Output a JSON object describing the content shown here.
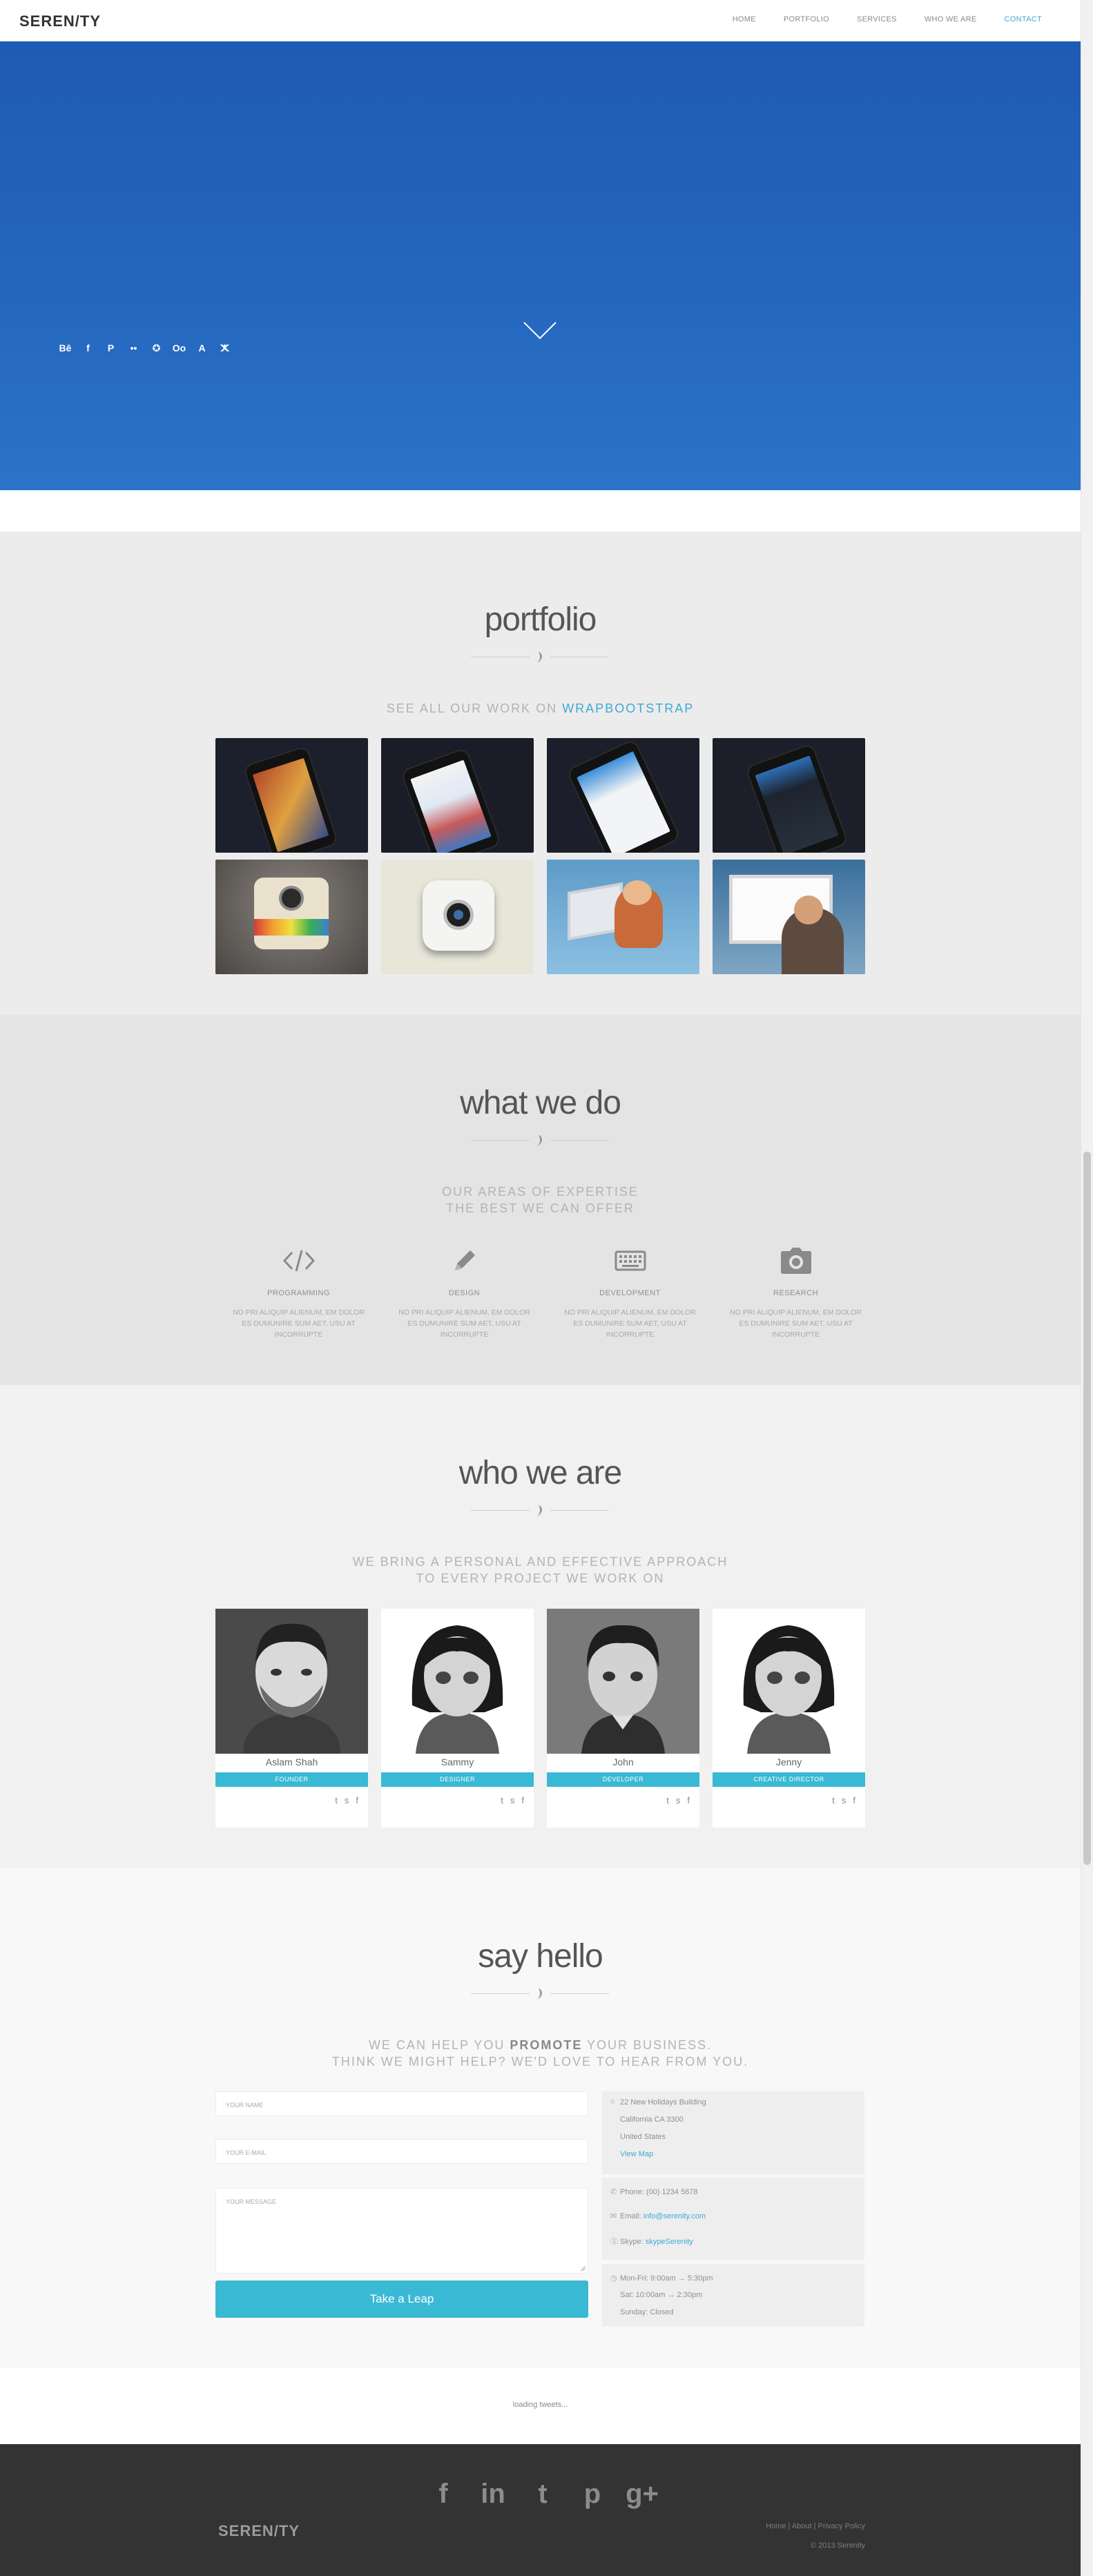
{
  "brand": "SEREN/TY",
  "nav": {
    "items": [
      "HOME",
      "PORTFOLIO",
      "SERVICES",
      "WHO WE ARE",
      "CONTACT"
    ],
    "active": "CONTACT"
  },
  "hero": {
    "social_icons": [
      "Bē",
      "f",
      "P",
      "••",
      "✪",
      "Oo",
      "A",
      "ⵅ"
    ]
  },
  "portfolio": {
    "title": "portfolio",
    "subtitle_prefix": "SEE ALL OUR WORK ON ",
    "subtitle_link": "WRAPBOOTSTRAP"
  },
  "services": {
    "title": "what we do",
    "subtitle_line1": "OUR AREAS OF EXPERTISE",
    "subtitle_line2": "THE BEST WE CAN OFFER",
    "items": [
      {
        "name": "PROGRAMMING",
        "icon": "code-icon",
        "text": "NO PRI ALIQUIP ALIENUM, EM DOLOR ES DUMUNIRE SUM AET, USU AT INCORRUPTE"
      },
      {
        "name": "DESIGN",
        "icon": "pencil-icon",
        "text": "NO PRI ALIQUIP ALIENUM, EM DOLOR ES DUMUNIRE SUM AET, USU AT INCORRUPTE"
      },
      {
        "name": "DEVELOPMENT",
        "icon": "keyboard-icon",
        "text": "NO PRI ALIQUIP ALIENUM, EM DOLOR ES DUMUNIRE SUM AET, USU AT INCORRUPTE"
      },
      {
        "name": "RESEARCH",
        "icon": "camera-icon",
        "text": "NO PRI ALIQUIP ALIENUM, EM DOLOR ES DUMUNIRE SUM AET, USU AT INCORRUPTE"
      }
    ]
  },
  "team": {
    "title": "who we are",
    "subtitle_line1": "WE BRING A PERSONAL AND EFFECTIVE APPROACH",
    "subtitle_line2": "TO EVERY PROJECT WE WORK ON",
    "members": [
      {
        "name": "Aslam Shah",
        "role": "FOUNDER"
      },
      {
        "name": "Sammy",
        "role": "DESIGNER"
      },
      {
        "name": "John",
        "role": "DEVELOPER"
      },
      {
        "name": "Jenny",
        "role": "CREATIVE DIRECTOR"
      }
    ]
  },
  "contact": {
    "title": "say hello",
    "subtitle_line1_a": "WE CAN HELP YOU ",
    "subtitle_line1_b": "PROMOTE",
    "subtitle_line1_c": " YOUR BUSINESS.",
    "subtitle_line2": "THINK WE MIGHT HELP? WE'D LOVE TO HEAR FROM YOU.",
    "name_placeholder": "YOUR NAME",
    "email_placeholder": "YOUR E-MAIL",
    "message_placeholder": "YOUR MESSAGE",
    "submit_label": "Take a Leap",
    "address_line1": "22 New Holidays Building",
    "address_line2": "California CA 3300",
    "address_line3": "United States",
    "view_map": "View Map",
    "phone": "Phone: (00) 1234 5678",
    "email_label": "Email: ",
    "email_value": "info@serenity.com",
    "skype_label": "Skype: ",
    "skype_value": "skypeSerenity",
    "hours_line1": "Mon-Fri: 9:00am → 5:30pm",
    "hours_line2": "Sat: 10:00am → 2:30pm",
    "hours_line3": "Sunday: Closed"
  },
  "tweets": {
    "loading": "loading tweets..."
  },
  "footer": {
    "social_icons": [
      "f",
      "in",
      "t",
      "p",
      "g+"
    ],
    "logo": "SEREN/TY",
    "links": "Home | About | Privacy Policy",
    "copyright": "© 2013 Serenity"
  }
}
